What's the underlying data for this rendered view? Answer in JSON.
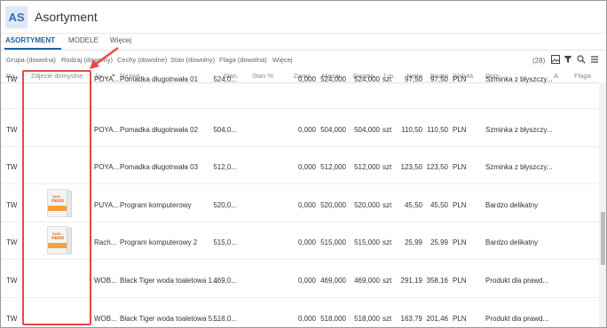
{
  "app": {
    "logo": "AS",
    "title": "Asortyment"
  },
  "tabs": [
    {
      "label": "ASORTYMENT",
      "active": true
    },
    {
      "label": "MODELE",
      "active": false
    },
    {
      "label": "Więcej",
      "active": false
    }
  ],
  "filters": [
    "Grupa (dowolna)",
    "Rodzaj (dowolny)",
    "Cechy (dowolne)",
    "Stan (dowolny)",
    "Flaga (dowolna)",
    "Więcej"
  ],
  "toolbar": {
    "count": "(28)",
    "icons": [
      "picture-icon",
      "filter-icon",
      "search-icon",
      "menu-icon"
    ]
  },
  "columns": [
    "Ro...",
    "Zdjecie domyslne",
    "Sy...",
    "Nazwa",
    "Stan",
    "Stan %",
    "Zarez...",
    "Niezar...",
    "Dostęp...",
    "J.m.",
    "Netto",
    "Brutto",
    "Waluta",
    "Opis",
    "A",
    "Flaga"
  ],
  "rows": [
    {
      "rodzaj": "TW",
      "photo": false,
      "symbol": "POYA...",
      "nazwa": "Pomadka długotrwała 01",
      "stan": "524,0...",
      "stan_pct": "",
      "zarez": "0,000",
      "niezar": "524,000",
      "dostep": "524,000",
      "jm": "szt",
      "netto": "97,50",
      "brutto": "97,50",
      "waluta": "PLN",
      "opis": "Szminka z błyszczy..."
    },
    {
      "rodzaj": "TW",
      "photo": false,
      "symbol": "POYA...",
      "nazwa": "Pomadka długotrwała 02",
      "stan": "504,0...",
      "stan_pct": "",
      "zarez": "0,000",
      "niezar": "504,000",
      "dostep": "504,000",
      "jm": "szt",
      "netto": "110,50",
      "brutto": "110,50",
      "waluta": "PLN",
      "opis": "Szminka z błyszczy..."
    },
    {
      "rodzaj": "TW",
      "photo": false,
      "symbol": "POYA...",
      "nazwa": "Pomadka długotrwała 03",
      "stan": "512,0...",
      "stan_pct": "",
      "zarez": "0,000",
      "niezar": "512,000",
      "dostep": "512,000",
      "jm": "szt",
      "netto": "123,50",
      "brutto": "123,50",
      "waluta": "PLN",
      "opis": "Szminka z błyszczy..."
    },
    {
      "rodzaj": "TW",
      "photo": true,
      "symbol": "PUYA...",
      "nazwa": "Program komputerowy",
      "stan": "520,0...",
      "stan_pct": "",
      "zarez": "0,000",
      "niezar": "520,000",
      "dostep": "520,000",
      "jm": "szt",
      "netto": "45,50",
      "brutto": "45,50",
      "waluta": "PLN",
      "opis": "Bardzo delikatny"
    },
    {
      "rodzaj": "TW",
      "photo": true,
      "symbol": "Rach...",
      "nazwa": "Program komputerowy 2",
      "stan": "515,0...",
      "stan_pct": "",
      "zarez": "0,000",
      "niezar": "515,000",
      "dostep": "515,000",
      "jm": "szt",
      "netto": "25,99",
      "brutto": "25,99",
      "waluta": "PLN",
      "opis": "Bardzo delikatny"
    },
    {
      "rodzaj": "TW",
      "photo": false,
      "symbol": "WOB...",
      "nazwa": "Black Tiger woda toaletowa 1...",
      "stan": "469,0...",
      "stan_pct": "",
      "zarez": "0,000",
      "niezar": "469,000",
      "dostep": "469,000",
      "jm": "szt",
      "netto": "291,19",
      "brutto": "358,16",
      "waluta": "PLN",
      "opis": "Produkt dla prawd..."
    },
    {
      "rodzaj": "TW",
      "photo": false,
      "symbol": "WOB...",
      "nazwa": "Black Tiger woda toaletowa 5...",
      "stan": "518,0...",
      "stan_pct": "",
      "zarez": "0,000",
      "niezar": "518,000",
      "dostep": "518,000",
      "jm": "szt",
      "netto": "163,79",
      "brutto": "201,46",
      "waluta": "PLN",
      "opis": "Produkt dla prawd..."
    }
  ],
  "thumbnail": {
    "line1": "Sello",
    "line2": "nexo"
  },
  "colors": {
    "accent": "#1f5fa8",
    "highlight": "#e84848"
  }
}
